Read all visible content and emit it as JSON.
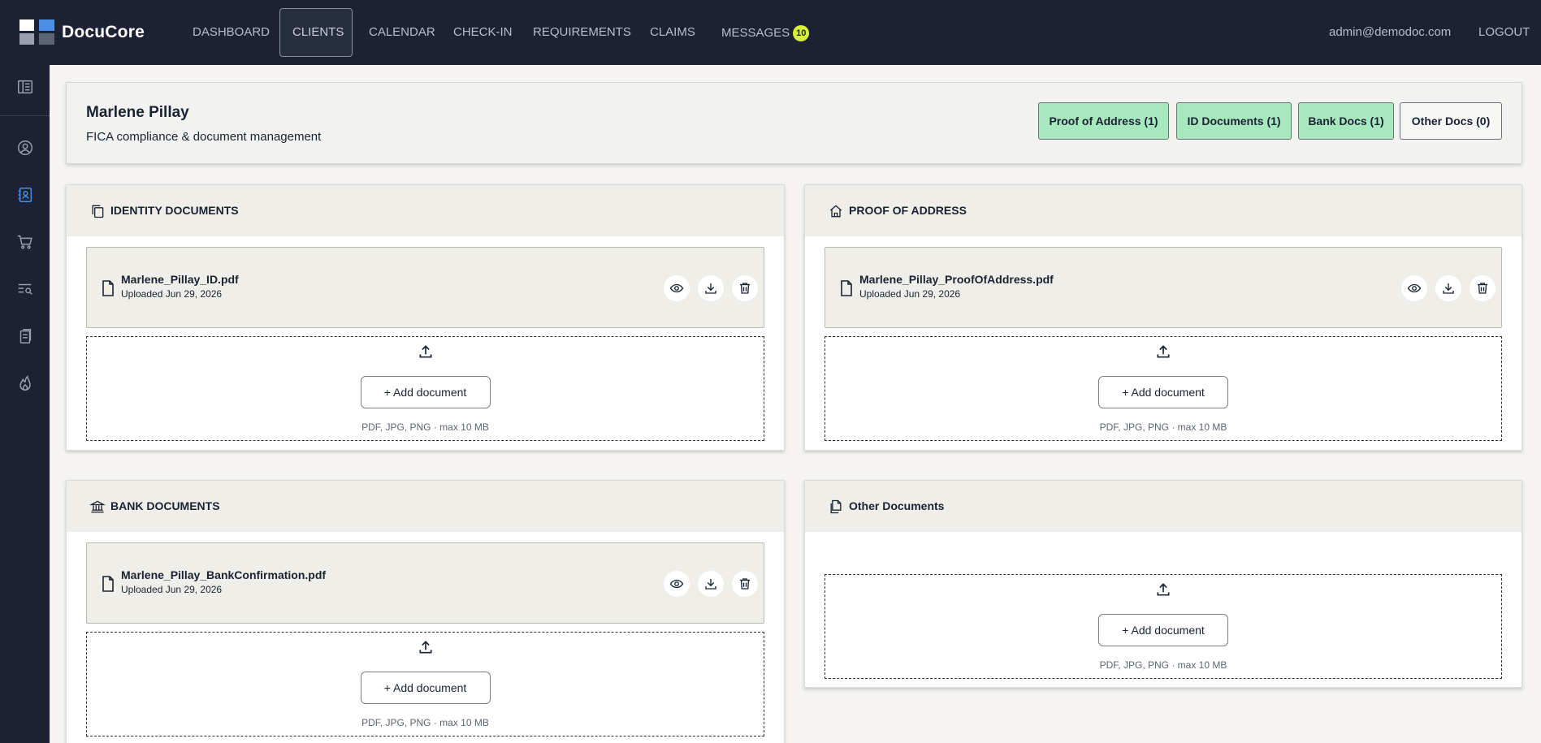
{
  "app": {
    "name": "DocuCore"
  },
  "nav": {
    "items": [
      "DASHBOARD",
      "CLIENTS",
      "CALENDAR",
      "CHECK-IN",
      "REQUIREMENTS",
      "CLAIMS",
      "MESSAGES"
    ],
    "active": "CLIENTS",
    "messages_count": "10",
    "user_email": "admin@demodoc.com",
    "logout_label": "LOGOUT"
  },
  "sidebar": {
    "icons": [
      "panel-icon",
      "user-circle-icon",
      "contacts-icon",
      "cart-icon",
      "list-search-icon",
      "documents-icon",
      "flame-icon"
    ],
    "active": "contacts-icon"
  },
  "client": {
    "name": "Marlene Pillay",
    "subtitle": "FICA compliance & document management",
    "filters": [
      {
        "label": "Proof of Address (1)",
        "state": "complete"
      },
      {
        "label": "ID Documents (1)",
        "state": "complete"
      },
      {
        "label": "Bank Docs (1)",
        "state": "complete"
      },
      {
        "label": "Other Docs (0)",
        "state": "empty"
      }
    ]
  },
  "sections": {
    "identity": {
      "title": "IDENTITY DOCUMENTS",
      "icon": "copy-icon",
      "files": [
        {
          "name": "Marlene_Pillay_ID.pdf",
          "date": "Uploaded Jun 29, 2026"
        }
      ]
    },
    "address": {
      "title": "PROOF OF ADDRESS",
      "icon": "home-icon",
      "files": [
        {
          "name": "Marlene_Pillay_ProofOfAddress.pdf",
          "date": "Uploaded Jun 29, 2026"
        }
      ]
    },
    "bank": {
      "title": "BANK DOCUMENTS",
      "icon": "bank-icon",
      "files": [
        {
          "name": "Marlene_Pillay_BankConfirmation.pdf",
          "date": "Uploaded Jun 29, 2026"
        }
      ]
    },
    "other": {
      "title": "Other Documents",
      "icon": "documents-icon",
      "files": []
    }
  },
  "upload": {
    "button_label": "+ Add document",
    "hint": "PDF, JPG, PNG · max 10 MB"
  },
  "colors": {
    "topbar": "#1c2233",
    "accent_blue": "#4a90e2",
    "badge": "#d8ef3a",
    "complete_pill": "#a8e8be"
  }
}
